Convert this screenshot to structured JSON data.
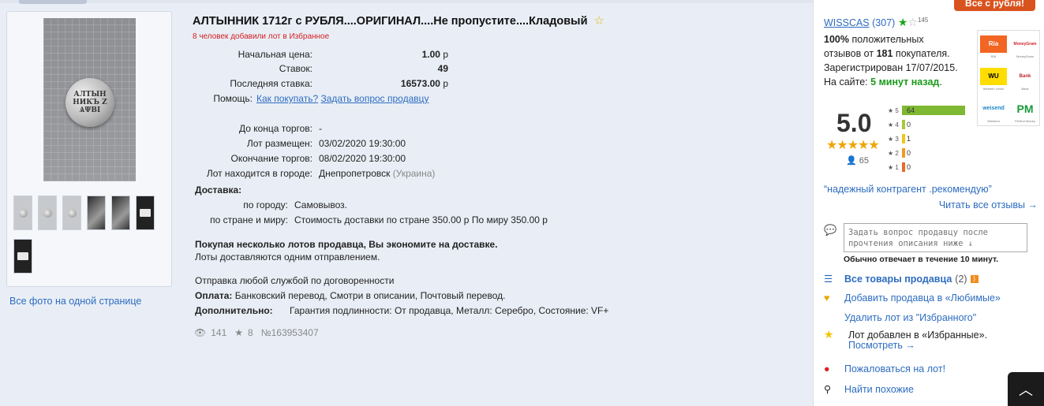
{
  "lot": {
    "title": "АЛТЫННИК 1712г с РУБЛЯ....ОРИГИНАЛ....Не пропустите....Кладовый",
    "favorites_note": "8 человек добавили лот в Избранное",
    "start_price_label": "Начальная цена:",
    "start_price": "1.00",
    "bids_label": "Ставок:",
    "bids": "49",
    "last_bid_label": "Последняя ставка:",
    "last_bid": "16573.00",
    "currency": "р",
    "help_label": "Помощь:",
    "help_how_to_buy": "Как покупать?",
    "help_ask_seller": "Задать вопрос продавцу",
    "time_left_label": "До конца торгов:",
    "time_left": "-",
    "posted_label": "Лот размещен:",
    "posted": "03/02/2020 19:30:00",
    "ends_label": "Окончание торгов:",
    "ends": "08/02/2020 19:30:00",
    "city_label": "Лот находится в городе:",
    "city": "Днепропетровск",
    "country": "(Украина)",
    "delivery_label": "Доставка:",
    "delivery_city_label": "по городу:",
    "delivery_city": "Самовывоз.",
    "delivery_world_label": "по стране и миру:",
    "delivery_world": "Стоимость доставки по стране 350.00 р По миру 350.00 р",
    "save_note_bold": "Покупая несколько лотов продавца, Вы экономите на доставке.",
    "save_note": "Лоты доставляются одним отправлением.",
    "shipping_note": "Отправка любой службой по договоренности",
    "payment_label": "Оплата:",
    "payment": "Банковский перевод, Смотри в описании, Почтовый перевод.",
    "extra_label": "Дополнительно:",
    "extra": "Гарантия подлинности: От продавца, Металл: Серебро, Состояние: VF+",
    "views": "141",
    "stars": "8",
    "lot_number": "№163953407"
  },
  "gallery": {
    "all_photos": "Все фото на одной странице",
    "coin_line1": "АЛТЫН",
    "coin_line2": "НИКЪ Z",
    "coin_line3": "ѦΨВІ"
  },
  "seller": {
    "promo": "Все с рубля!",
    "name": "WISSCAS",
    "rating_count": "(307)",
    "stars_count": "145",
    "positive_pct": "100%",
    "positive_text": "положительных",
    "reviews_prefix": "отзывов от",
    "reviews_count": "181",
    "reviews_suffix": "покупателя.",
    "registered": "Зарегистрирован 17/07/2015.",
    "online_label": "На сайте:",
    "online_value": "5 минут назад",
    "rating": "5.0",
    "votes": "65",
    "distribution": [
      {
        "label": "★ 5",
        "value": "64",
        "fraction": 1.0,
        "color": "#7fb832"
      },
      {
        "label": "★ 4",
        "value": "0",
        "fraction": 0.0,
        "color": "#a7c935"
      },
      {
        "label": "★ 3",
        "value": "1",
        "fraction": 0.0,
        "color": "#f0c419"
      },
      {
        "label": "★ 2",
        "value": "0",
        "fraction": 0.0,
        "color": "#f29a1f"
      },
      {
        "label": "★ 1",
        "value": "0",
        "fraction": 0.0,
        "color": "#e96a2a"
      }
    ],
    "quote": "“надежный контрагент .рекомендую”",
    "read_all": "Читать все отзывы →",
    "ask_placeholder": "Задать вопрос продавцу после прочтения описания ниже ↓",
    "reply_note": "Обычно отвечает в течение 10 минут.",
    "all_goods": "Все товары продавца",
    "all_goods_count": "(2)",
    "add_favorite": "Добавить продавца в «Любимые»",
    "remove_lot": "Удалить лот из \"Избранного\"",
    "lot_added": "Лот добавлен в «Избранные».",
    "look": "Посмотреть →",
    "complain": "Пожаловаться на лот!",
    "similar": "Найти похожие"
  },
  "payments": [
    {
      "name": "Ria",
      "caption": "RIA"
    },
    {
      "name": "MoneyGram",
      "caption": "MoneyGram"
    },
    {
      "name": "WU",
      "caption": "Western Union"
    },
    {
      "name": "Bank",
      "caption": "Bank"
    },
    {
      "name": "weisend",
      "caption": "Weisend"
    },
    {
      "name": "PM",
      "caption": "Perfect Money"
    }
  ]
}
